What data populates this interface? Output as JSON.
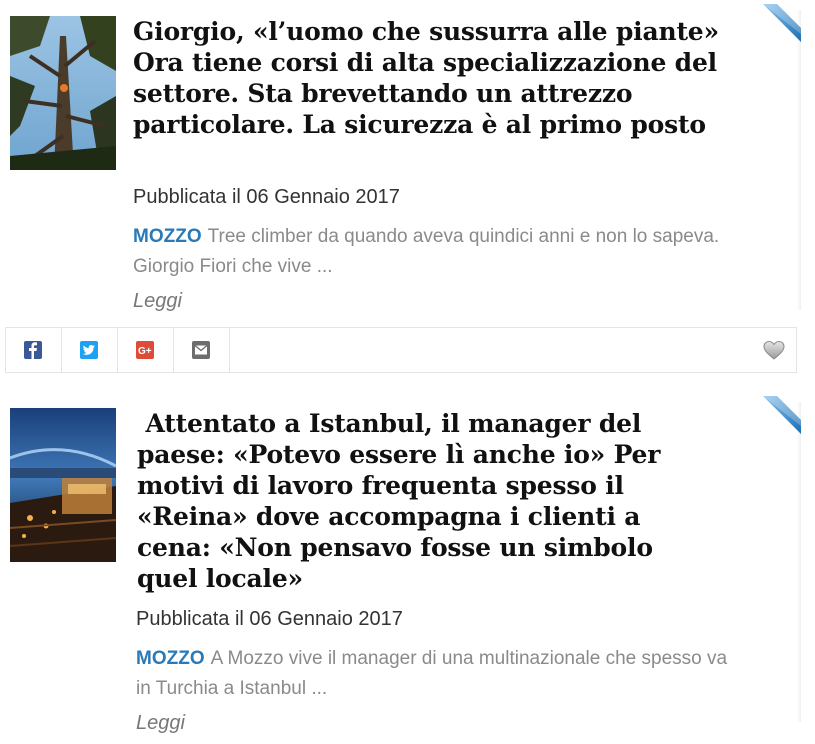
{
  "articles": [
    {
      "headline": "Giorgio, «l’uomo che sussurra alle piante» Ora tiene corsi di alta specializzazione del settore. Sta brevettando un attrezzo particolare. La sicurezza è al primo posto",
      "date": "Pubblicata il 06 Gennaio 2017",
      "location": "MOZZO",
      "excerpt": "Tree climber da quando aveva quindici anni e non lo sapeva. Giorgio Fiori che vive ...",
      "read_more": "Leggi"
    },
    {
      "headline": " Attentato a Istanbul, il manager del paese: «Potevo essere lì anche io» Per motivi di lavoro frequenta spesso il «Reina» dove accompagna i clienti a cena: «Non pensavo fosse un simbolo quel locale»",
      "date": "Pubblicata il 06 Gennaio 2017",
      "location": "MOZZO",
      "excerpt": "A Mozzo vive il manager di una multinazionale che spesso va in Turchia a Istanbul ...",
      "read_more": "Leggi"
    }
  ],
  "share_bar": {
    "buttons": [
      {
        "icon": "facebook-icon",
        "color": "#3b5998"
      },
      {
        "icon": "twitter-icon",
        "color": "#1da1f2"
      },
      {
        "icon": "google-plus-icon",
        "color": "#dd4b39"
      },
      {
        "icon": "email-icon",
        "color": "#6d6d6d"
      }
    ],
    "like_icon": "heart-icon"
  },
  "colors": {
    "location": "#2a7ab8",
    "headline": "#111111",
    "corner_ribbon": "#2e86c9"
  }
}
